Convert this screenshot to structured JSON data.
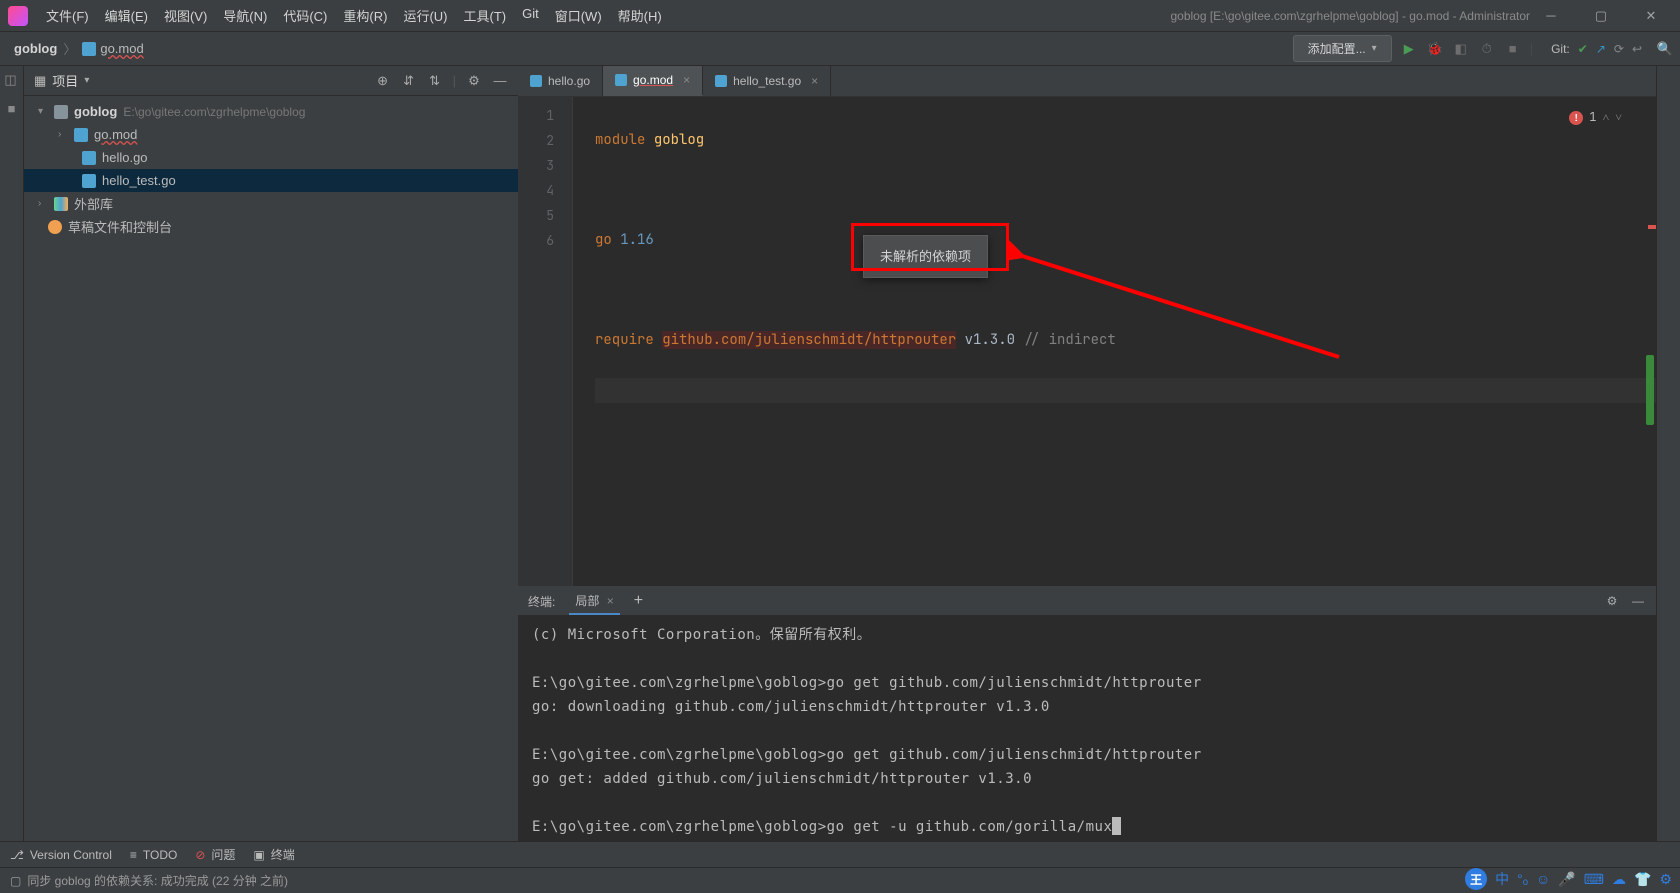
{
  "window": {
    "title": "goblog [E:\\go\\gitee.com\\zgrhelpme\\goblog] - go.mod - Administrator"
  },
  "menubar": {
    "items": [
      "文件(F)",
      "编辑(E)",
      "视图(V)",
      "导航(N)",
      "代码(C)",
      "重构(R)",
      "运行(U)",
      "工具(T)",
      "Git",
      "窗口(W)",
      "帮助(H)"
    ]
  },
  "breadcrumb": {
    "project": "goblog",
    "file": "go.mod"
  },
  "navbar": {
    "run_config": "添加配置...",
    "git_label": "Git:"
  },
  "project_panel": {
    "title": "项目",
    "root": {
      "name": "goblog",
      "path": "E:\\go\\gitee.com\\zgrhelpme\\goblog"
    },
    "files": [
      {
        "name": "go.mod",
        "icon": "go"
      },
      {
        "name": "hello.go",
        "icon": "go"
      },
      {
        "name": "hello_test.go",
        "icon": "go"
      }
    ],
    "external_libs": "外部库",
    "scratches": "草稿文件和控制台"
  },
  "editor": {
    "tabs": [
      {
        "label": "hello.go",
        "active": false,
        "close": "×"
      },
      {
        "label": "go.mod",
        "active": true,
        "close": "×"
      },
      {
        "label": "hello_test.go",
        "active": false,
        "close": "×"
      }
    ],
    "lines": [
      "1",
      "2",
      "3",
      "4",
      "5",
      "6"
    ],
    "code": {
      "l1_kw": "module",
      "l1_mod": "goblog",
      "l3_kw": "go",
      "l3_ver": "1.16",
      "l5_kw": "require",
      "l5_pkg": "github.com/julienschmidt/httprouter",
      "l5_ver": "v1.3.0",
      "l5_cmt": "// indirect"
    },
    "tooltip": "未解析的依赖项",
    "errors": {
      "count": "1"
    }
  },
  "terminal": {
    "header": {
      "title": "终端:",
      "tab": "局部",
      "plus": "+"
    },
    "lines": [
      "(c) Microsoft Corporation。保留所有权利。",
      "",
      "E:\\go\\gitee.com\\zgrhelpme\\goblog>go get github.com/julienschmidt/httprouter",
      "go: downloading github.com/julienschmidt/httprouter v1.3.0",
      "",
      "E:\\go\\gitee.com\\zgrhelpme\\goblog>go get github.com/julienschmidt/httprouter",
      "go get: added github.com/julienschmidt/httprouter v1.3.0",
      "",
      "E:\\go\\gitee.com\\zgrhelpme\\goblog>go get -u github.com/gorilla/mux"
    ]
  },
  "bottom_tools": {
    "version_control": "Version Control",
    "todo": "TODO",
    "problems": "问题",
    "terminal": "终端"
  },
  "status_bar": {
    "text": "同步 goblog 的依赖关系: 成功完成 (22 分钟 之前)"
  },
  "ime": {
    "main": "王",
    "lang": "中"
  }
}
